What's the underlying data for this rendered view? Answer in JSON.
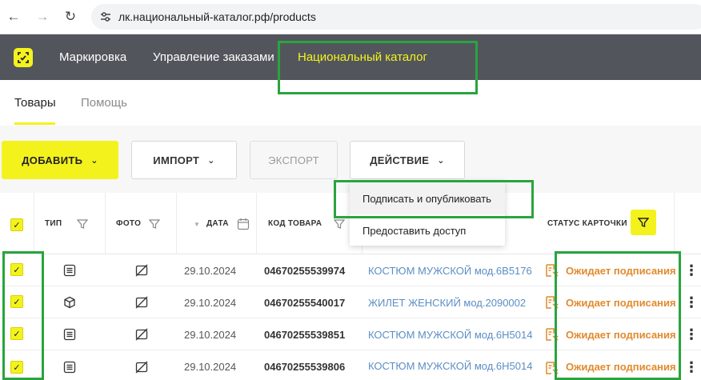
{
  "browser": {
    "url": "лк.национальный-каталог.рф/products"
  },
  "header": {
    "menu": [
      {
        "label": "Маркировка"
      },
      {
        "label": "Управление заказами"
      },
      {
        "label": "Национальный каталог",
        "active": true
      }
    ],
    "accent_color": "#f4f21d",
    "bg_color": "#52565c"
  },
  "subtabs": [
    {
      "label": "Товары",
      "active": true
    },
    {
      "label": "Помощь"
    }
  ],
  "toolbar": {
    "add_label": "ДОБАВИТЬ",
    "import_label": "ИМПОРТ",
    "export_label": "ЭКСПОРТ",
    "action_label": "ДЕЙСТВИЕ"
  },
  "dropdown": {
    "items": [
      {
        "label": "Подписать и опубликовать"
      },
      {
        "label": "Предоставить доступ"
      }
    ]
  },
  "table": {
    "columns": {
      "type": "ТИП",
      "photo": "ФОТО",
      "date": "ДАТА",
      "code": "КОД ТОВАРА",
      "status": "СТАТУС КАРТОЧКИ"
    },
    "rows": [
      {
        "type_icon": "list-icon",
        "date": "29.10.2024",
        "code": "04670255539974",
        "name": "КОСТЮМ МУЖСКОЙ мод.6В5176",
        "status": "Ожидает подписания"
      },
      {
        "type_icon": "box-icon",
        "date": "29.10.2024",
        "code": "04670255540017",
        "name": "ЖИЛЕТ ЖЕНСКИЙ мод.2090002",
        "status": "Ожидает подписания"
      },
      {
        "type_icon": "list-icon",
        "date": "29.10.2024",
        "code": "04670255539851",
        "name": "КОСТЮМ МУЖСКОЙ мод.6Н5014",
        "status": "Ожидает подписания"
      },
      {
        "type_icon": "list-icon",
        "date": "29.10.2024",
        "code": "04670255539806",
        "name": "КОСТЮМ МУЖСКОЙ мод.6Н5014",
        "status": "Ожидает подписания"
      }
    ],
    "status_color": "#e08a2d",
    "link_color": "#5b8ec4"
  },
  "annotation_color": "#2aa43e"
}
